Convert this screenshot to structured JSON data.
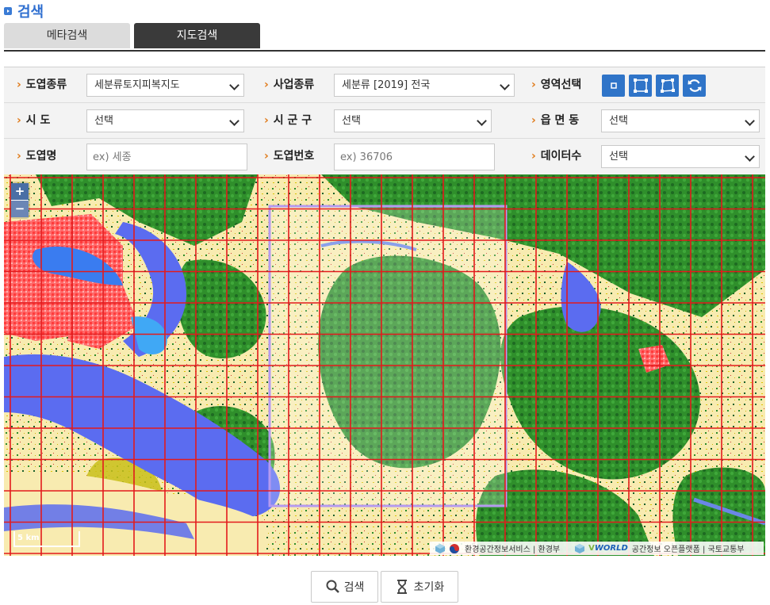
{
  "page": {
    "title": "검색"
  },
  "tabs": [
    {
      "label": "메타검색",
      "active": false
    },
    {
      "label": "지도검색",
      "active": true
    }
  ],
  "form": {
    "map_type": {
      "label": "도엽종류",
      "value": "세분류토지피복지도"
    },
    "project_type": {
      "label": "사업종류",
      "value": "세분류 [2019] 전국"
    },
    "area_select": {
      "label": "영역선택",
      "tools": [
        "point-select-icon",
        "rectangle-select-icon",
        "polygon-select-icon",
        "refresh-icon"
      ]
    },
    "sido": {
      "label": "시 도",
      "value": "선택"
    },
    "sigungu": {
      "label": "시 군 구",
      "value": "선택"
    },
    "eupmyeondong": {
      "label": "읍 면 동",
      "value": "선택"
    },
    "sheet_name": {
      "label": "도엽명",
      "placeholder": "ex) 세종"
    },
    "sheet_number": {
      "label": "도엽번호",
      "placeholder": "ex) 36706"
    },
    "data_count": {
      "label": "데이터수",
      "value": "선택"
    }
  },
  "map": {
    "zoom_in": "+",
    "zoom_out": "−",
    "scale": "5 km",
    "attribution_1": "환경공간정보서비스 | 환경부",
    "attribution_vworld": "WORLD",
    "attribution_2": "공간정보 오픈플랫폼 | 국토교통부",
    "grid_color": "#e31a1c",
    "selection_color": "#b59af0",
    "colors": {
      "water": "#5b6cf0",
      "farmland": "#f9eaa8",
      "forest": "#2e8b2a",
      "dark_forest": "#1a5e2a",
      "urban": "#ff5050"
    }
  },
  "actions": {
    "search_label": "검색",
    "reset_label": "초기화"
  }
}
